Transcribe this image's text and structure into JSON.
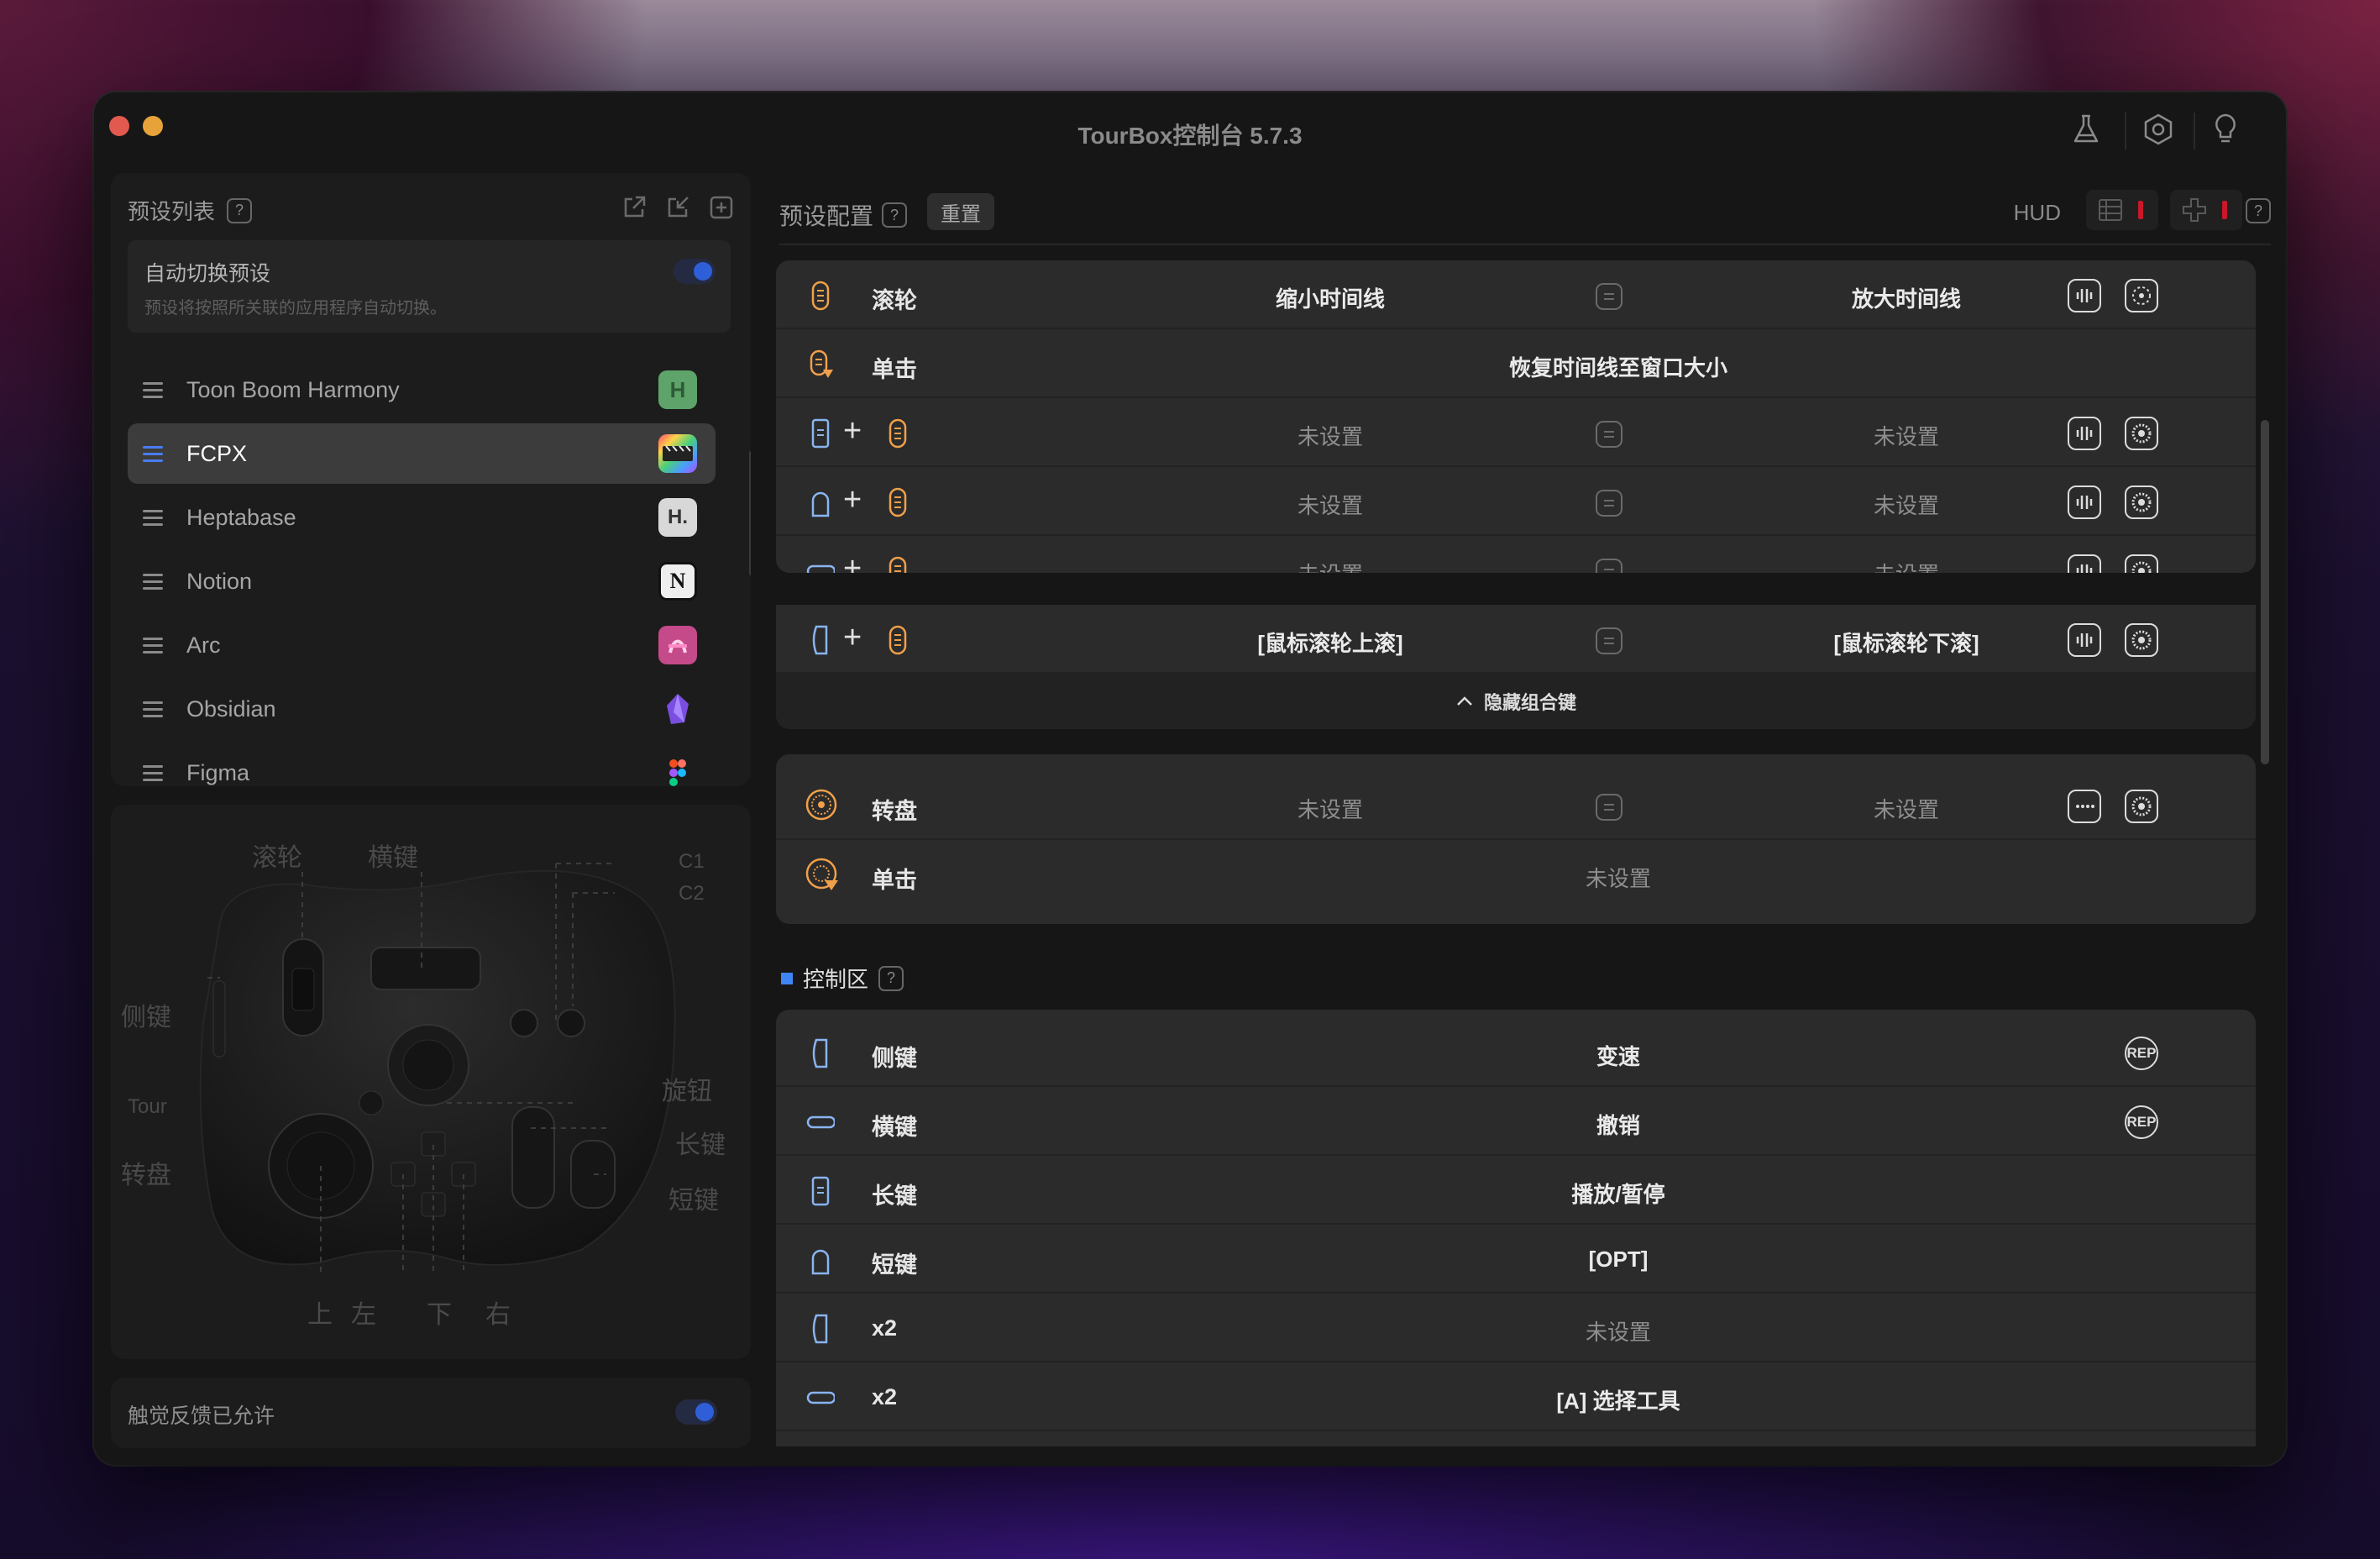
{
  "window": {
    "title": "TourBox控制台 5.7.3"
  },
  "sidebar": {
    "header": "预设列表",
    "help": "?",
    "auto_switch": {
      "title": "自动切换预设",
      "desc": "预设将按照所关联的应用程序自动切换。",
      "enabled": true
    },
    "presets": [
      {
        "label": "Toon Boom Harmony",
        "icon": "H",
        "color": "#5ea36a",
        "selected": false
      },
      {
        "label": "FCPX",
        "icon": "fcpx-icon",
        "color": "#333333",
        "selected": true
      },
      {
        "label": "Heptabase",
        "icon": "H.",
        "color": "#d8d8d8",
        "selected": false
      },
      {
        "label": "Notion",
        "icon": "N",
        "color": "#eeeeee",
        "selected": false
      },
      {
        "label": "Arc",
        "icon": "arc-icon",
        "color": "#e07ac0",
        "selected": false
      },
      {
        "label": "Obsidian",
        "icon": "obsidian-icon",
        "color": "#8a5cf0",
        "selected": false
      },
      {
        "label": "Figma",
        "icon": "figma-icon",
        "color": "#f24e1e",
        "selected": false
      }
    ]
  },
  "device_labels": {
    "wheel": "滚轮",
    "hkey": "横键",
    "c1": "C1",
    "c2": "C2",
    "side": "侧键",
    "tour": "Tour",
    "knob": "旋钮",
    "tall": "长键",
    "dial": "转盘",
    "short": "短键",
    "up": "上",
    "left": "左",
    "down": "下",
    "right": "右"
  },
  "haptic": {
    "label": "触觉反馈已允许",
    "enabled": true
  },
  "config": {
    "title": "预设配置",
    "help": "?",
    "reset": "重置",
    "hud": "HUD",
    "help2": "?"
  },
  "wheel_card": {
    "rows": [
      {
        "name": "滚轮",
        "left": "缩小时间线",
        "right": "放大时间线"
      },
      {
        "name": "单击",
        "center": "恢复时间线至窗口大小"
      },
      {
        "combo": "tall-key+wheel",
        "left": "未设置",
        "right": "未设置"
      },
      {
        "combo": "short-key+wheel",
        "left": "未设置",
        "right": "未设置"
      },
      {
        "combo": "h-key+wheel",
        "left": "未设置",
        "right": "未设置"
      },
      {
        "combo": "side-key+wheel",
        "left": "[鼠标滚轮上滚]",
        "right": "[鼠标滚轮下滚]"
      }
    ],
    "hide_combo": "隐藏组合键"
  },
  "dial_card": {
    "rows": [
      {
        "name": "转盘",
        "left": "未设置",
        "right": "未设置"
      },
      {
        "name": "单击",
        "center": "未设置"
      }
    ]
  },
  "control_section": {
    "label": "控制区",
    "help": "?",
    "rows": [
      {
        "name": "侧键",
        "value": "变速",
        "rep": "REP"
      },
      {
        "name": "横键",
        "value": "撤销",
        "rep": "REP"
      },
      {
        "name": "长键",
        "value": "播放/暂停"
      },
      {
        "name": "短键",
        "value": "[OPT]"
      },
      {
        "name": "x2",
        "value": "未设置"
      },
      {
        "name": "x2",
        "value": "[A] 选择工具"
      }
    ]
  },
  "colors": {
    "accent_orange": "#f0a04a",
    "accent_blue": "#4a7cf0",
    "toggle_blue": "#2e5fd8",
    "hud_red": "#c8182a"
  }
}
